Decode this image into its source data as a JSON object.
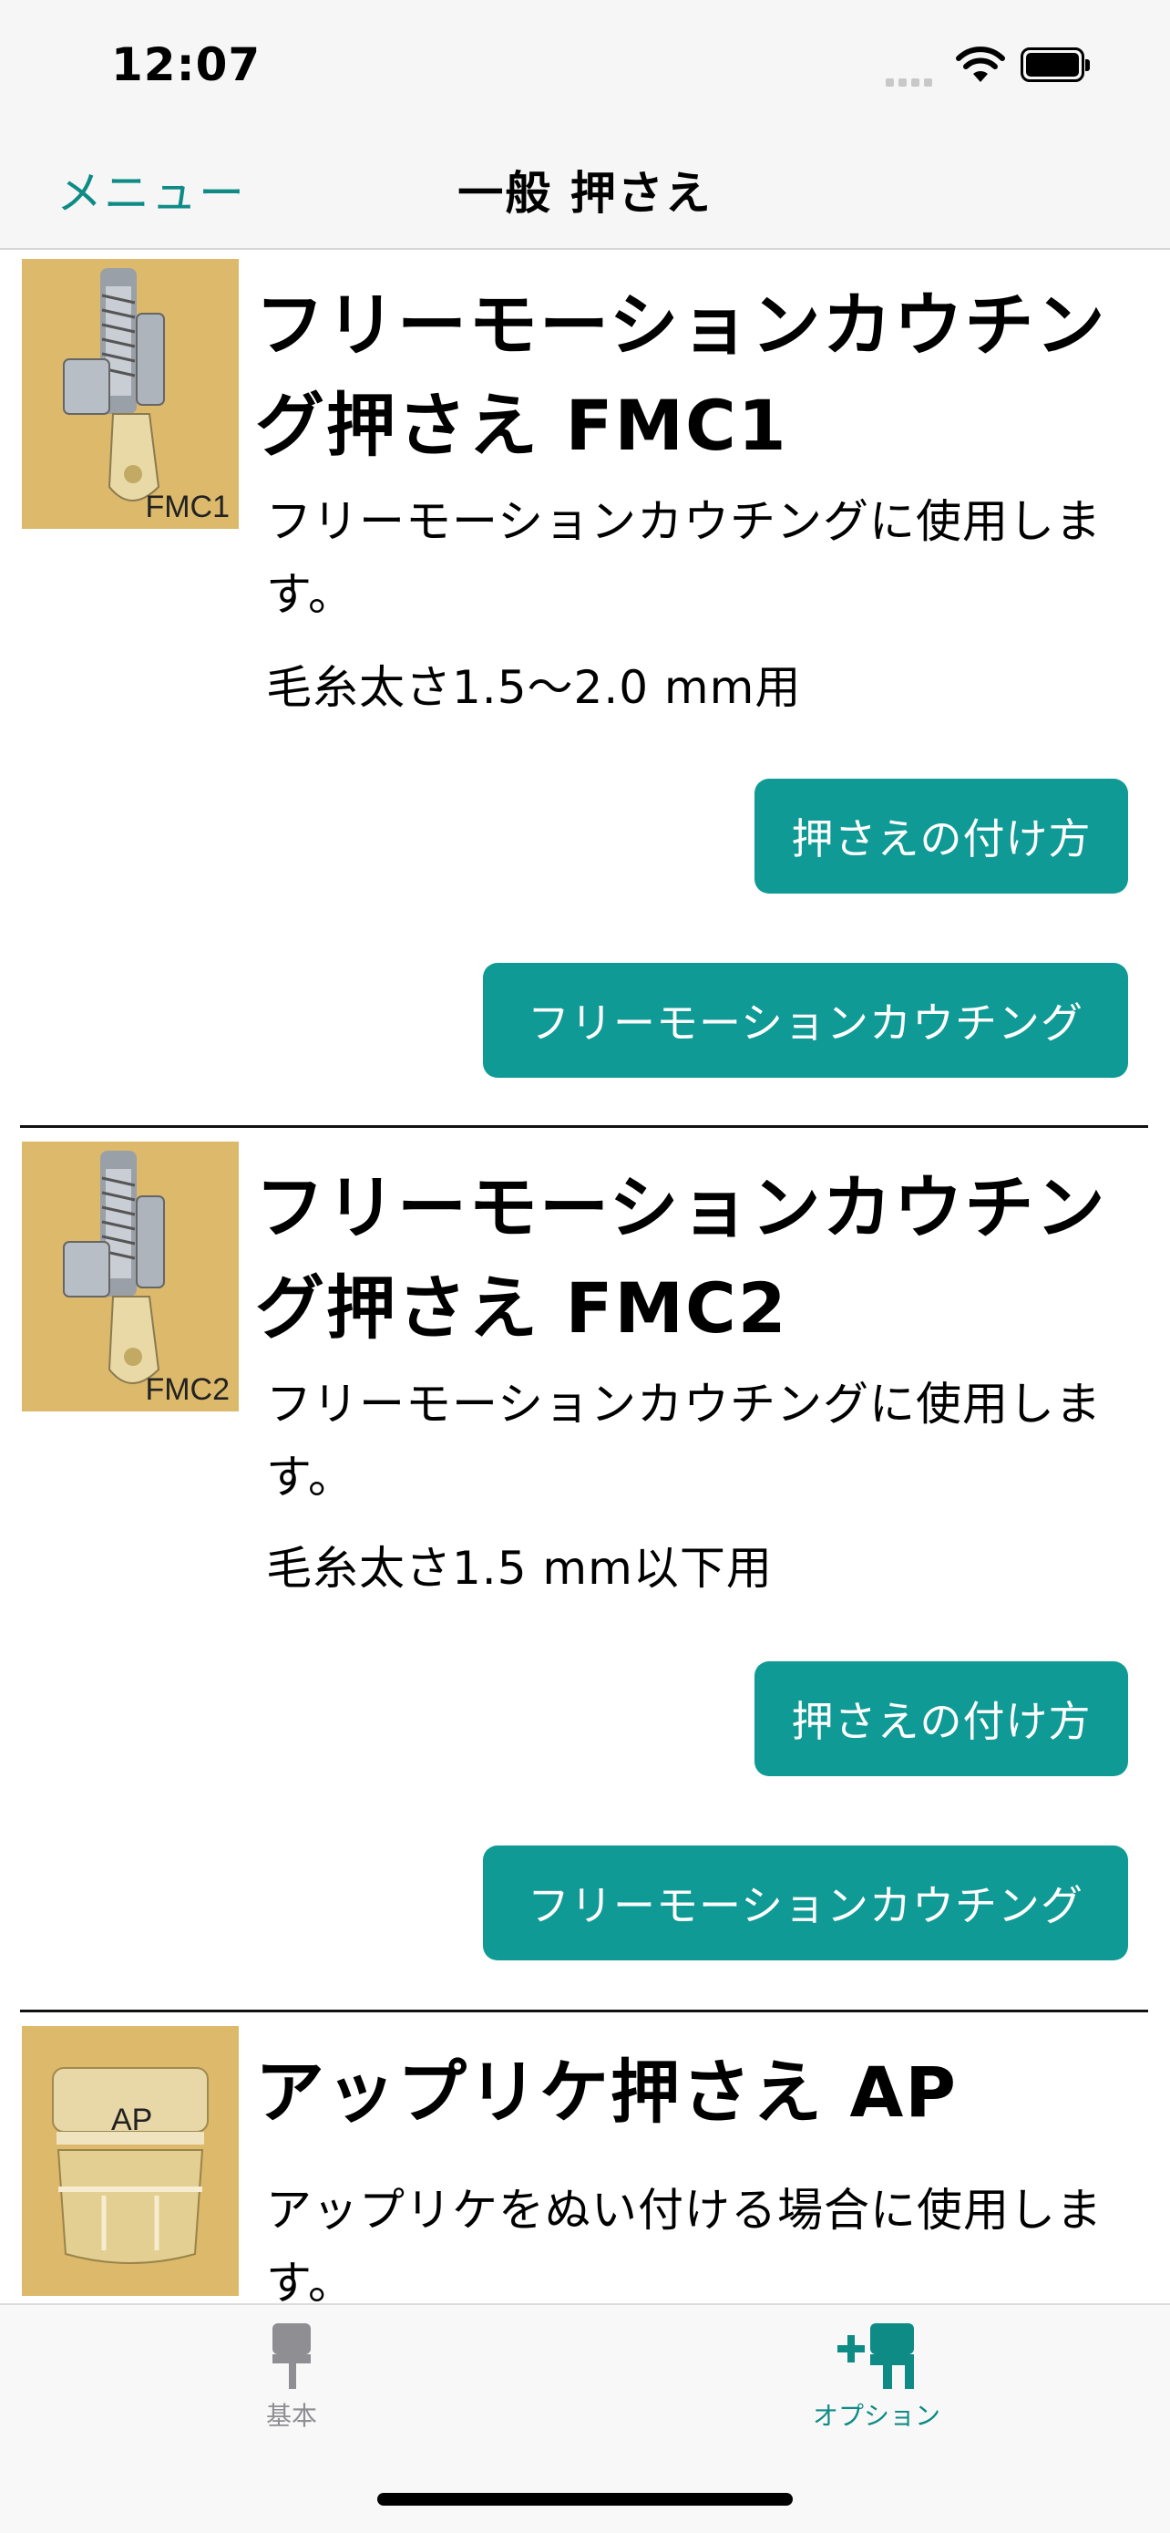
{
  "status": {
    "time": "12:07"
  },
  "nav": {
    "back_label": "メニュー",
    "title": "一般 押さえ"
  },
  "items": [
    {
      "thumb_label": "FMC1",
      "title": "フリーモーションカウチング押さえ FMC1",
      "description": "フリーモーションカウチングに使用します。",
      "spec": "毛糸太さ1.5〜2.0 mm用",
      "buttons": [
        "押さえの付け方",
        "フリーモーションカウチング"
      ]
    },
    {
      "thumb_label": "FMC2",
      "title": "フリーモーションカウチング押さえ FMC2",
      "description": "フリーモーションカウチングに使用します。",
      "spec": "毛糸太さ1.5 mm以下用",
      "buttons": [
        "押さえの付け方",
        "フリーモーションカウチング"
      ]
    },
    {
      "thumb_label": "AP",
      "title": "アップリケ押さえ AP",
      "description": "アップリケをぬい付ける場合に使用します。"
    }
  ],
  "tabs": [
    {
      "label": "基本",
      "icon": "presser-foot-icon",
      "selected": false
    },
    {
      "label": "オプション",
      "icon": "presser-foot-plus-icon",
      "selected": true
    }
  ],
  "colors": {
    "accent": "#0f9a95",
    "link": "#0f8b86",
    "thumb_bg": "#dcb96b",
    "tab_inactive": "#8e8e93"
  }
}
